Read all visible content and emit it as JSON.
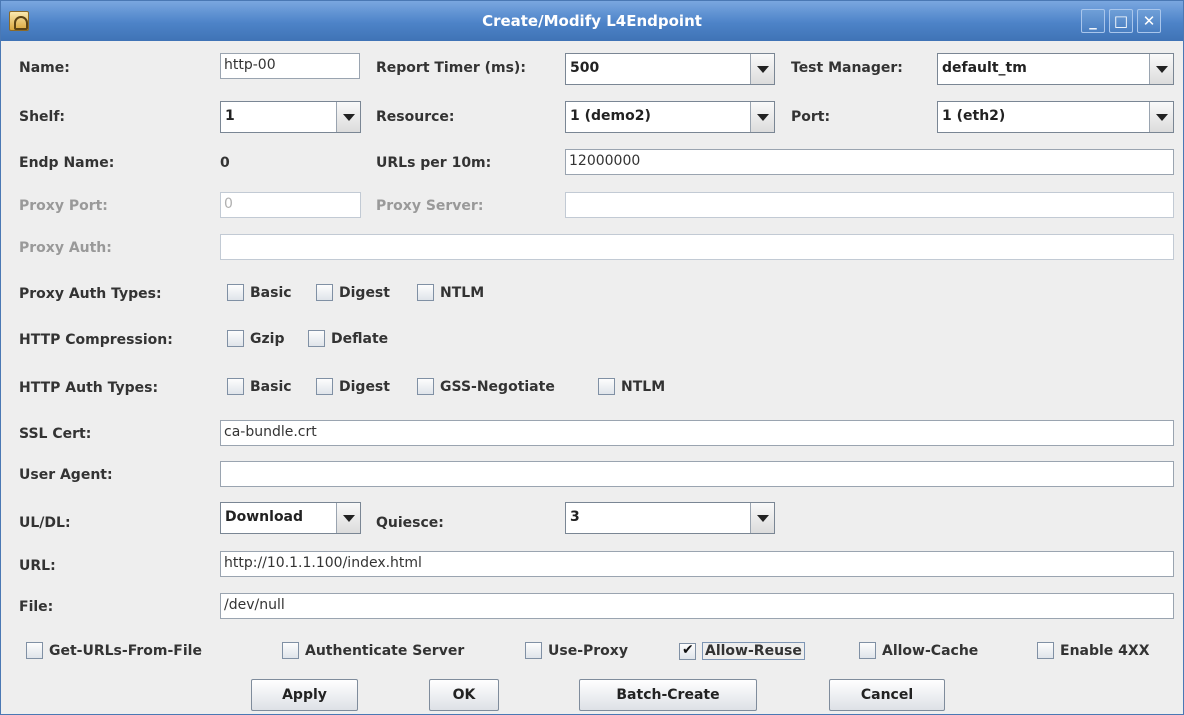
{
  "window": {
    "title": "Create/Modify L4Endpoint",
    "minimize_glyph": "_",
    "maximize_glyph": "□",
    "close_glyph": "✕"
  },
  "labels": {
    "name": "Name:",
    "report_timer": "Report Timer (ms):",
    "test_manager": "Test Manager:",
    "shelf": "Shelf:",
    "resource": "Resource:",
    "port": "Port:",
    "endp_name": "Endp Name:",
    "urls_per_10m": "URLs per 10m:",
    "proxy_port": "Proxy Port:",
    "proxy_server": "Proxy Server:",
    "proxy_auth": "Proxy Auth:",
    "proxy_auth_types": "Proxy Auth Types:",
    "http_compression": "HTTP Compression:",
    "http_auth_types": "HTTP Auth Types:",
    "ssl_cert": "SSL Cert:",
    "user_agent": "User Agent:",
    "ul_dl": "UL/DL:",
    "quiesce": "Quiesce:",
    "url": "URL:",
    "file": "File:"
  },
  "fields": {
    "name": "http-00",
    "report_timer": "500",
    "test_manager": "default_tm",
    "shelf": "1",
    "resource": "1 (demo2)",
    "port": "1 (eth2)",
    "endp_name": "0",
    "urls_per_10m": "12000000",
    "proxy_port": "0",
    "proxy_server": "",
    "proxy_auth": "",
    "ssl_cert": "ca-bundle.crt",
    "user_agent": "",
    "ul_dl": "Download",
    "quiesce": "3",
    "url": "http://10.1.1.100/index.html",
    "file": "/dev/null"
  },
  "proxy_auth_types": [
    {
      "label": "Basic",
      "checked": false
    },
    {
      "label": "Digest",
      "checked": false
    },
    {
      "label": "NTLM",
      "checked": false
    }
  ],
  "http_compression": [
    {
      "label": "Gzip",
      "checked": false
    },
    {
      "label": "Deflate",
      "checked": false
    }
  ],
  "http_auth_types": [
    {
      "label": "Basic",
      "checked": false
    },
    {
      "label": "Digest",
      "checked": false
    },
    {
      "label": "GSS-Negotiate",
      "checked": false
    },
    {
      "label": "NTLM",
      "checked": false
    }
  ],
  "options": [
    {
      "label": "Get-URLs-From-File",
      "checked": false
    },
    {
      "label": "Authenticate Server",
      "checked": false
    },
    {
      "label": "Use-Proxy",
      "checked": false
    },
    {
      "label": "Allow-Reuse",
      "checked": true
    },
    {
      "label": "Allow-Cache",
      "checked": false
    },
    {
      "label": "Enable 4XX",
      "checked": false
    }
  ],
  "buttons": {
    "apply": "Apply",
    "ok": "OK",
    "batch_create": "Batch-Create",
    "cancel": "Cancel"
  }
}
